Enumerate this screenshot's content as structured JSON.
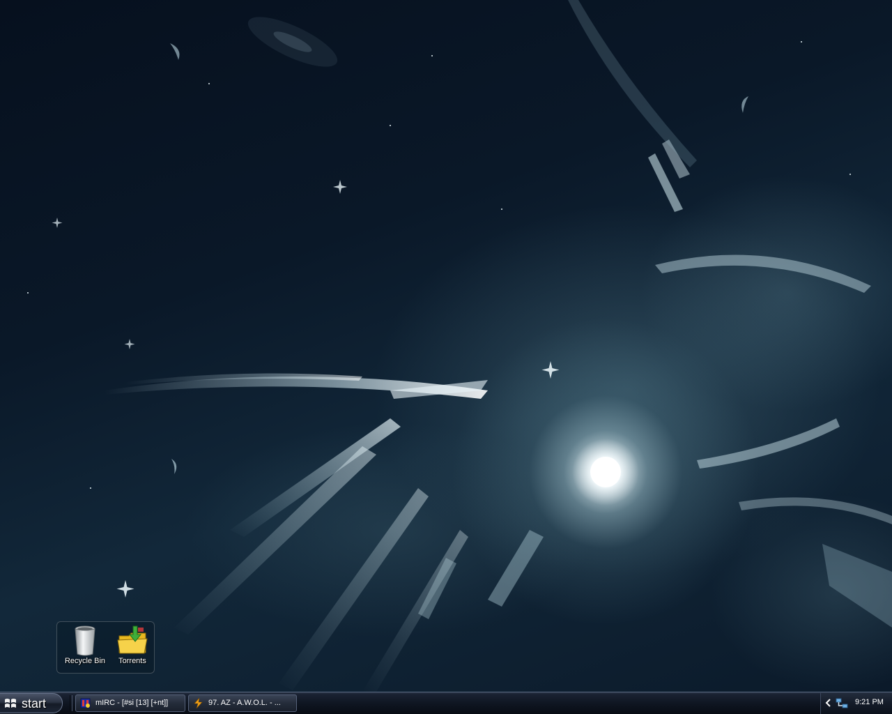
{
  "desktop": {
    "wallpaper": "abstract-space-nebula",
    "accent_color": "#9fc3cf",
    "icons": [
      {
        "label": "Recycle Bin",
        "icon": "recycle-bin-icon"
      },
      {
        "label": "Torrents",
        "icon": "folder-download-icon"
      }
    ]
  },
  "taskbar": {
    "start_label": "start",
    "tasks": [
      {
        "label": "mIRC - [#si [13] [+nt]]",
        "icon": "mirc-icon"
      },
      {
        "label": "97. AZ - A.W.O.L. - ...",
        "icon": "winamp-icon"
      }
    ],
    "tray": {
      "clock": "9:21 PM",
      "icons": [
        "show-hidden-chevron-icon",
        "network-icon"
      ]
    }
  }
}
